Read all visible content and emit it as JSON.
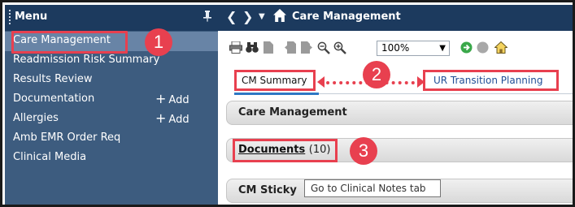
{
  "sidebar": {
    "title": "Menu",
    "items": [
      {
        "label": "Care Management",
        "add_label": ""
      },
      {
        "label": "Readmission Risk Summary",
        "add_label": ""
      },
      {
        "label": "Results Review",
        "add_label": ""
      },
      {
        "label": "Documentation",
        "add_label": "Add"
      },
      {
        "label": "Allergies",
        "add_label": "Add"
      },
      {
        "label": "Amb EMR Order Req",
        "add_label": ""
      },
      {
        "label": "Clinical Media",
        "add_label": ""
      }
    ]
  },
  "header": {
    "title": "Care Management"
  },
  "toolbar": {
    "zoom": "100%"
  },
  "tabs": [
    {
      "label": "CM Summary"
    },
    {
      "label": "UR Transition Planning"
    }
  ],
  "sections": {
    "care_management": "Care Management",
    "documents": "Documents",
    "documents_count": "(10)",
    "cm_sticky": "CM Sticky"
  },
  "tooltip": "Go to Clinical Notes tab",
  "annotations": [
    "1",
    "2",
    "3"
  ],
  "colors": {
    "annotation": "#e8404f",
    "header_bg": "#1c3a5e",
    "sidebar_bg": "#3d5c7f",
    "sidebar_selected": "#6884a6",
    "tab_link": "#1f4e96"
  }
}
